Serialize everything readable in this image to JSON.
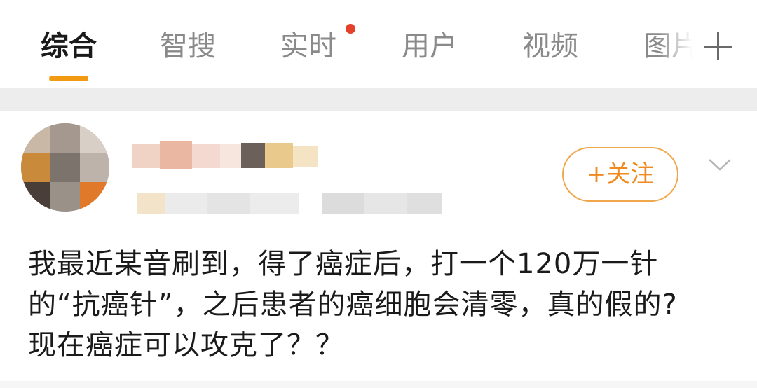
{
  "tabs": [
    {
      "label": "综合",
      "active": true
    },
    {
      "label": "智搜",
      "active": false
    },
    {
      "label": "实时",
      "active": false,
      "badge": "red-dot"
    },
    {
      "label": "用户",
      "active": false
    },
    {
      "label": "视频",
      "active": false
    },
    {
      "label": "图片",
      "active": false
    }
  ],
  "tab_add_icon": "plus-icon",
  "colors": {
    "accent": "#f29a13",
    "follow": "#f08a1f",
    "badge": "#e5402c"
  },
  "post": {
    "follow_label": "+关注",
    "menu_icon": "chevron-down-icon",
    "text_lines": [
      "我最近某音刷到，得了癌症后，打一个120万一针",
      "的“抗癌针”，之后患者的癌细胞会清零，真的假的?",
      "现在癌症可以攻克了？？"
    ]
  }
}
